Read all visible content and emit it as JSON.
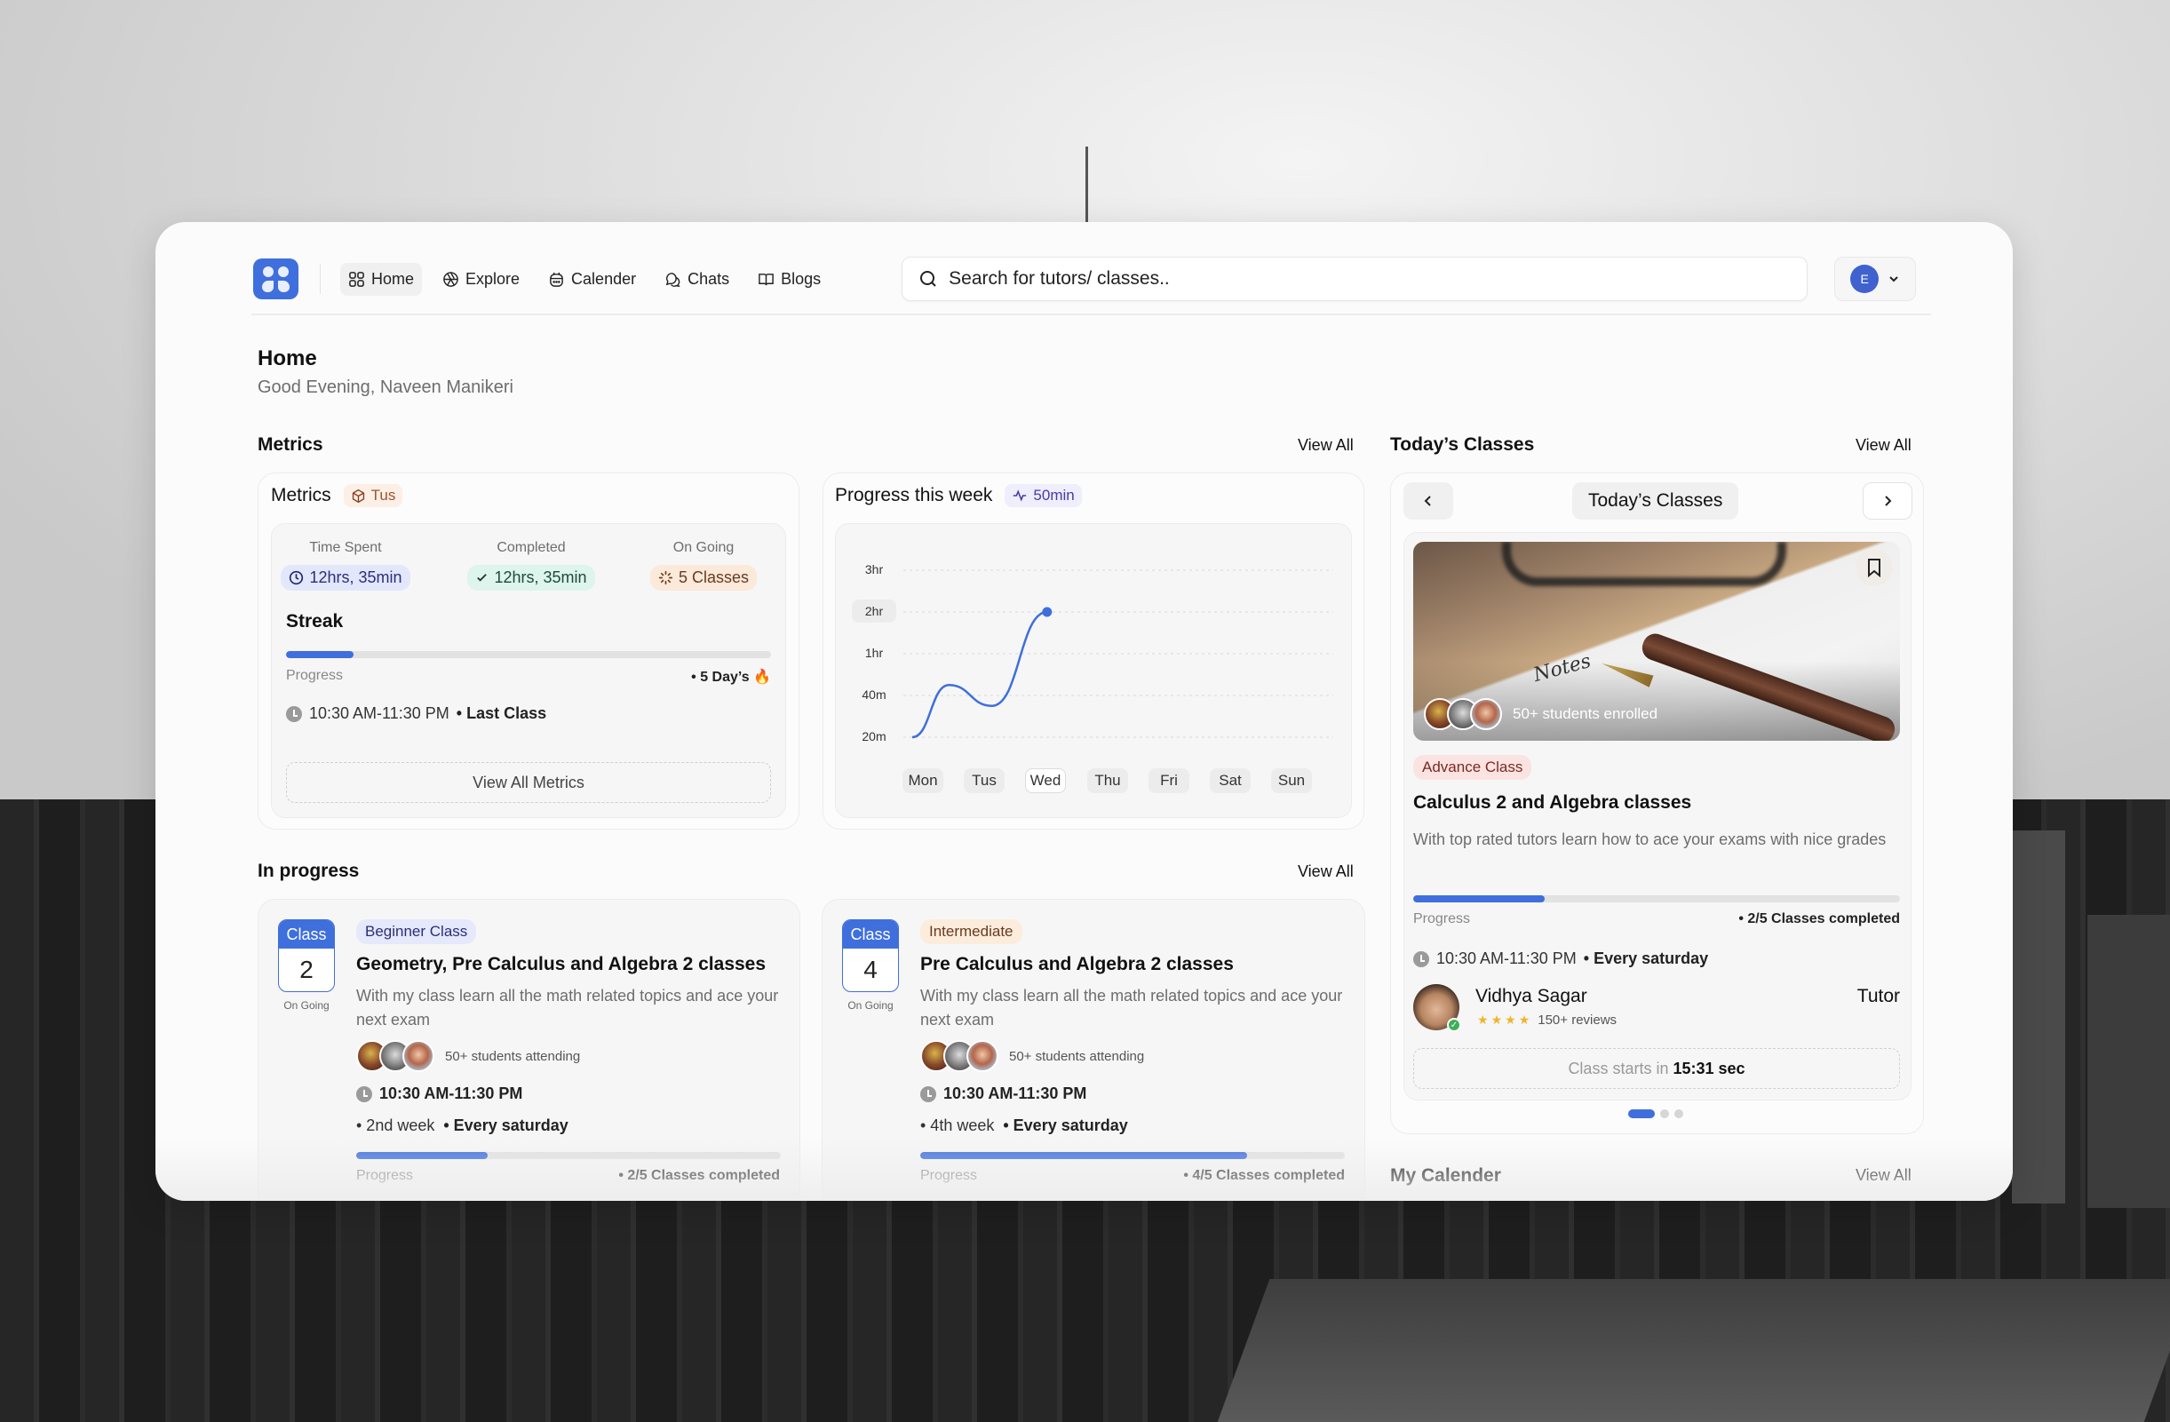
{
  "nav": {
    "items": [
      {
        "label": "Home",
        "icon": "grid-icon",
        "active": true
      },
      {
        "label": "Explore",
        "icon": "aperture-icon"
      },
      {
        "label": "Calender",
        "icon": "calendar-icon"
      },
      {
        "label": "Chats",
        "icon": "chat-icon"
      },
      {
        "label": "Blogs",
        "icon": "book-icon"
      }
    ],
    "search_placeholder": "Search for tutors/ classes..",
    "user_initial": "E"
  },
  "page": {
    "title": "Home",
    "greeting": "Good Evening, Naveen Manikeri"
  },
  "sections": {
    "metrics": "Metrics",
    "in_progress": "In progress",
    "todays_classes": "Today’s Classes",
    "my_calender": "My Calender",
    "view_all": "View All"
  },
  "metrics_card": {
    "title": "Metrics",
    "day_chip": "Tus",
    "time_spent": {
      "label": "Time Spent",
      "value": "12hrs, 35min"
    },
    "completed": {
      "label": "Completed",
      "value": "12hrs, 35min"
    },
    "ongoing": {
      "label": "On Going",
      "value": "5 Classes"
    },
    "streak_title": "Streak",
    "streak_progress": 0.14,
    "progress_label": "Progress",
    "streak_days": "• 5 Day’s 🔥",
    "time": "10:30 AM-11:30 PM",
    "last_class": "• Last Class",
    "view_all_button": "View All Metrics"
  },
  "chart_data": {
    "type": "line",
    "title": "Progress this week",
    "badge": "50min",
    "categories": [
      "Mon",
      "Tus",
      "Wed",
      "Thu",
      "Fri",
      "Sat",
      "Sun"
    ],
    "selected_day": "Wed",
    "y_ticks": [
      "20m",
      "40m",
      "1hr",
      "2hr",
      "3hr"
    ],
    "highlighted_tick": "2hr",
    "series": [
      {
        "name": "Progress",
        "values_tick_index": [
          0,
          1.25,
          0.75,
          3
        ],
        "x_points": [
          0,
          0.6,
          1.3,
          2.2
        ]
      }
    ],
    "grid": true
  },
  "in_progress": [
    {
      "class_label": "Class",
      "class_number": "2",
      "status": "On Going",
      "level": "Beginner Class",
      "title": "Geometry, Pre Calculus and Algebra 2 classes",
      "description": "With my class learn all the math related topics and ace your next exam",
      "students": "50+ students attending",
      "time": "10:30 AM-11:30 PM",
      "week": "• 2nd week",
      "schedule": "•  Every saturday",
      "progress": 0.31,
      "progress_label": "Progress",
      "completed": "• 2/5 Classes completed"
    },
    {
      "class_label": "Class",
      "class_number": "4",
      "status": "On Going",
      "level": "Intermediate",
      "title": "Pre Calculus and Algebra 2 classes",
      "description": "With my class learn all the math related topics and ace your next exam",
      "students": "50+ students attending",
      "time": "10:30 AM-11:30 PM",
      "week": "• 4th week",
      "schedule": "•  Every saturday",
      "progress": 0.77,
      "progress_label": "Progress",
      "completed": "• 4/5 Classes completed"
    }
  ],
  "todays_class": {
    "header": "Today’s Classes",
    "enrolled": "50+ students enrolled",
    "photo_text": "Notes",
    "level": "Advance Class",
    "title": "Calculus 2 and Algebra classes",
    "description": "With top rated tutors learn how to ace your exams with nice grades",
    "progress": 0.27,
    "progress_label": "Progress",
    "completed": "• 2/5 Classes completed",
    "time": "10:30 AM-11:30 PM",
    "schedule": "•  Every saturday",
    "tutor_name": "Vidhya Sagar",
    "tutor_role": "Tutor",
    "rating": 4,
    "reviews": "150+ reviews",
    "starts_prefix": "Class starts in ",
    "starts_time": "15:31 sec",
    "carousel_index": 0,
    "carousel_count": 3
  },
  "colors": {
    "accent": "#3f6fdc",
    "time_chip_bg": "#e3e7fb",
    "completed_chip_bg": "#ddf5ec",
    "ongoing_chip_bg": "#fbe9da",
    "advance_chip_bg": "#fbe3e1",
    "beginner_chip_bg": "#e6e8fb",
    "intermediate_chip_bg": "#fcecdc"
  }
}
